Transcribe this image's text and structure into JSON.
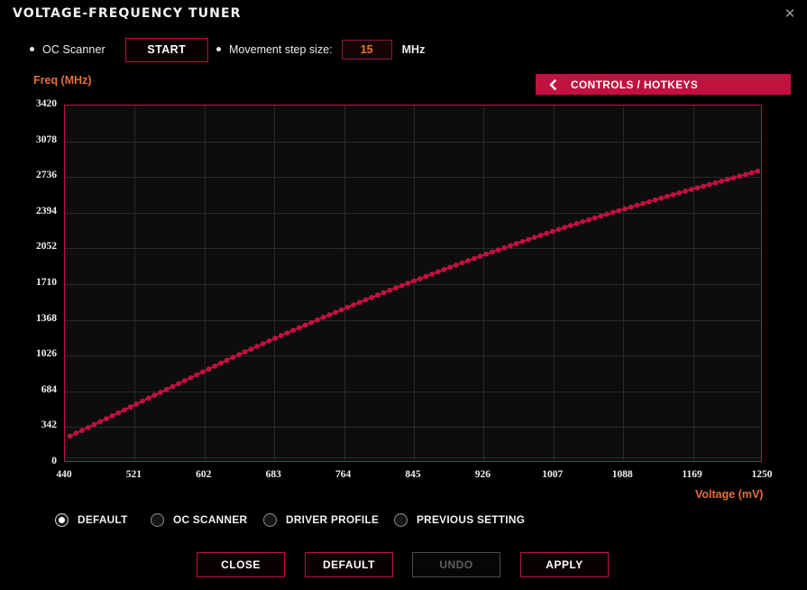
{
  "window": {
    "title": "VOLTAGE-FREQUENCY TUNER",
    "close_icon": "close-icon",
    "close_glyph": "✕",
    "accent_color": "#c2103f",
    "orange_color": "#e2703a",
    "background_color": "#000000",
    "plot_background_color": "#0d0d0d"
  },
  "controls": {
    "oc_scanner_label": "OC Scanner",
    "start_button": "START",
    "step_label": "Movement step size:",
    "step_value": "15",
    "step_unit": "MHz",
    "hotkeys_label": "CONTROLS / HOTKEYS",
    "hotkeys_icon": "chevron-left-icon"
  },
  "chart_data": {
    "type": "line",
    "title": "",
    "xlabel": "Voltage (mV)",
    "ylabel": "Freq (MHz)",
    "xlim": [
      440,
      1250
    ],
    "ylim": [
      0,
      3420
    ],
    "xticks": [
      440,
      521,
      602,
      683,
      764,
      845,
      926,
      1007,
      1088,
      1169,
      1250
    ],
    "yticks": [
      0,
      342,
      684,
      1026,
      1368,
      1710,
      2052,
      2394,
      2736,
      3078,
      3420
    ],
    "grid": true,
    "legend": "none",
    "series": [
      {
        "name": "OC Scanner curve",
        "color": "#c2103f",
        "marker": "circle",
        "x": [
          446,
          453,
          460,
          467,
          474,
          481,
          488,
          495,
          502,
          509,
          516,
          523,
          530,
          537,
          544,
          551,
          558,
          565,
          572,
          579,
          586,
          593,
          600,
          607,
          614,
          621,
          628,
          635,
          642,
          649,
          656,
          663,
          670,
          677,
          684,
          691,
          698,
          705,
          712,
          719,
          726,
          733,
          740,
          747,
          754,
          761,
          768,
          775,
          782,
          789,
          796,
          803,
          810,
          817,
          824,
          831,
          838,
          845,
          852,
          859,
          866,
          873,
          880,
          887,
          894,
          901,
          908,
          915,
          922,
          929,
          936,
          943,
          950,
          957,
          964,
          971,
          978,
          985,
          992,
          999,
          1006,
          1013,
          1020,
          1027,
          1034,
          1041,
          1048,
          1055,
          1062,
          1069,
          1076,
          1083,
          1090,
          1097,
          1104,
          1111,
          1118,
          1125,
          1132,
          1139,
          1146,
          1153,
          1160,
          1167,
          1174,
          1181,
          1188,
          1195,
          1202,
          1209,
          1216,
          1223,
          1230,
          1237,
          1244
        ],
        "y": [
          255,
          283,
          310,
          338,
          366,
          394,
          422,
          450,
          478,
          506,
          534,
          562,
          590,
          618,
          646,
          674,
          702,
          730,
          758,
          786,
          814,
          842,
          870,
          898,
          926,
          954,
          982,
          1010,
          1036,
          1062,
          1088,
          1114,
          1140,
          1166,
          1192,
          1218,
          1243,
          1268,
          1293,
          1318,
          1343,
          1368,
          1392,
          1416,
          1440,
          1464,
          1488,
          1512,
          1536,
          1560,
          1583,
          1606,
          1629,
          1652,
          1674,
          1696,
          1718,
          1740,
          1762,
          1784,
          1806,
          1828,
          1850,
          1872,
          1893,
          1914,
          1935,
          1956,
          1977,
          1998,
          2018,
          2038,
          2058,
          2078,
          2098,
          2118,
          2138,
          2158,
          2177,
          2196,
          2215,
          2234,
          2253,
          2272,
          2290,
          2308,
          2326,
          2344,
          2362,
          2380,
          2397,
          2414,
          2431,
          2448,
          2465,
          2482,
          2499,
          2516,
          2533,
          2550,
          2567,
          2584,
          2600,
          2616,
          2632,
          2648,
          2664,
          2680,
          2696,
          2712,
          2728,
          2744,
          2760,
          2776,
          2792
        ]
      }
    ]
  },
  "mode_options": [
    {
      "label": "DEFAULT",
      "selected": true
    },
    {
      "label": "OC SCANNER",
      "selected": false
    },
    {
      "label": "DRIVER PROFILE",
      "selected": false
    },
    {
      "label": "PREVIOUS SETTING",
      "selected": false
    }
  ],
  "footer_buttons": [
    {
      "label": "CLOSE",
      "disabled": false
    },
    {
      "label": "DEFAULT",
      "disabled": false
    },
    {
      "label": "UNDO",
      "disabled": true
    },
    {
      "label": "APPLY",
      "disabled": false
    }
  ]
}
